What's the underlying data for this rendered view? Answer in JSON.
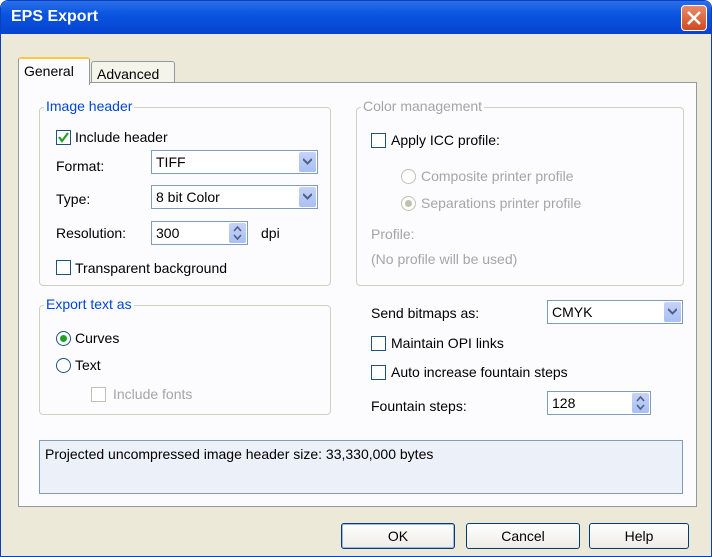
{
  "window": {
    "title": "EPS Export"
  },
  "tabs": [
    {
      "label": "General"
    },
    {
      "label": "Advanced"
    }
  ],
  "image_header": {
    "legend": "Image header",
    "include_header": {
      "label": "Include header",
      "checked": true
    },
    "format": {
      "label": "Format:",
      "value": "TIFF"
    },
    "type": {
      "label": "Type:",
      "value": "8 bit Color"
    },
    "resolution": {
      "label": "Resolution:",
      "value": "300",
      "unit": "dpi"
    },
    "transparent_background": {
      "label": "Transparent background",
      "checked": false
    }
  },
  "color_management": {
    "legend": "Color management",
    "apply_icc": {
      "label": "Apply ICC profile:",
      "checked": false
    },
    "composite": {
      "label": "Composite printer profile"
    },
    "separations": {
      "label": "Separations printer profile"
    },
    "profile_label": "Profile:",
    "profile_value": "(No profile will be used)"
  },
  "export_text": {
    "legend": "Export text as",
    "curves": {
      "label": "Curves",
      "selected": true
    },
    "text": {
      "label": "Text",
      "selected": false
    },
    "include_fonts": {
      "label": "Include fonts",
      "checked": false
    }
  },
  "bitmaps": {
    "send_label": "Send bitmaps as:",
    "send_value": "CMYK",
    "maintain_opi": {
      "label": "Maintain OPI links",
      "checked": false
    },
    "auto_fountain": {
      "label": "Auto increase fountain steps",
      "checked": false
    },
    "fountain_label": "Fountain steps:",
    "fountain_value": "128"
  },
  "info_text": "Projected uncompressed image header size: 33,330,000 bytes",
  "buttons": {
    "ok": "OK",
    "cancel": "Cancel",
    "help": "Help"
  }
}
